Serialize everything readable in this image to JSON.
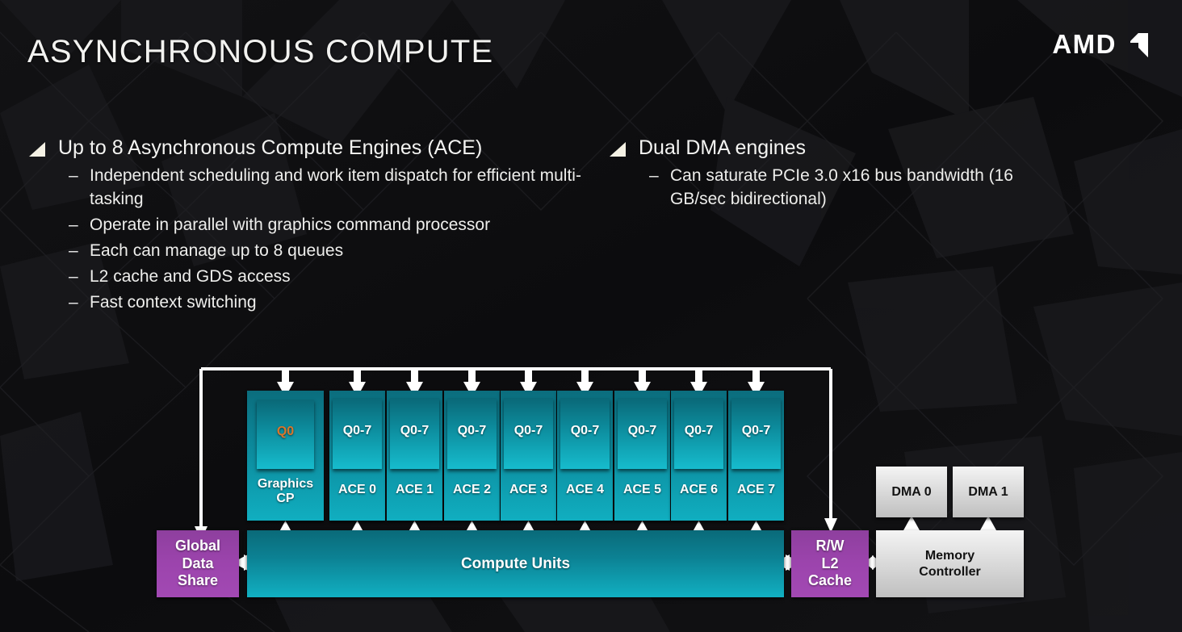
{
  "slide": {
    "title": "ASYNCHRONOUS COMPUTE",
    "logo": {
      "word": "AMD",
      "mark": "amd-arrow-mark"
    },
    "colors": {
      "background": "#0d0d0f",
      "teal_dark": "#0b6d7d",
      "teal_light": "#10aec0",
      "purple": "#9c44ad",
      "gray": "#dcdcdc",
      "accent_orange": "#d9762b",
      "text": "#f4f4f2"
    }
  },
  "bullets": {
    "left": {
      "heading": "Up to 8 Asynchronous Compute Engines (ACE)",
      "items": [
        "Independent scheduling and work item dispatch for efficient multi-tasking",
        "Operate in parallel with graphics command processor",
        "Each can manage up to 8 queues",
        "L2 cache and GDS access",
        "Fast context switching"
      ]
    },
    "right": {
      "heading": "Dual DMA engines",
      "items": [
        "Can saturate PCIe 3.0 x16 bus bandwidth (16 GB/sec bidirectional)"
      ]
    },
    "dash": "–"
  },
  "diagram": {
    "engines": [
      {
        "queue": "Q0",
        "name": "Graphics\nCP",
        "queue_accent": true
      },
      {
        "queue": "Q0-7",
        "name": "ACE 0",
        "queue_accent": false
      },
      {
        "queue": "Q0-7",
        "name": "ACE 1",
        "queue_accent": false
      },
      {
        "queue": "Q0-7",
        "name": "ACE 2",
        "queue_accent": false
      },
      {
        "queue": "Q0-7",
        "name": "ACE 3",
        "queue_accent": false
      },
      {
        "queue": "Q0-7",
        "name": "ACE 4",
        "queue_accent": false
      },
      {
        "queue": "Q0-7",
        "name": "ACE 5",
        "queue_accent": false
      },
      {
        "queue": "Q0-7",
        "name": "ACE 6",
        "queue_accent": false
      },
      {
        "queue": "Q0-7",
        "name": "ACE 7",
        "queue_accent": false
      }
    ],
    "compute_units": "Compute Units",
    "global_data_share": "Global\nData\nShare",
    "l2_cache": "R/W\nL2\nCache",
    "dma": [
      "DMA 0",
      "DMA 1"
    ],
    "memory_controller": "Memory\nController"
  }
}
